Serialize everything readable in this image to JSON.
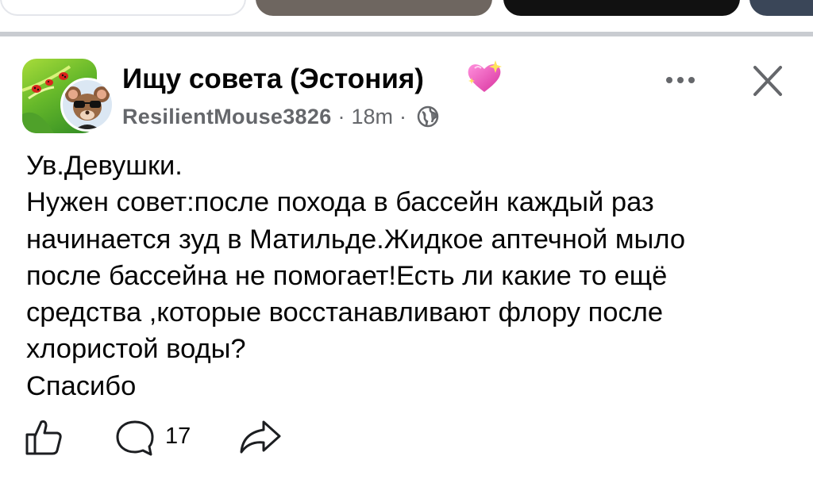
{
  "post": {
    "group_name": "Ищу совета (Эстония)",
    "author": "ResilientMouse3826",
    "separator_1": "·",
    "time": "18m",
    "separator_2": "·",
    "body_lines": [
      "Ув.Девушки.",
      "Нужен совет:после похода в бассейн каждый раз",
      "начинается зуд в Матильде.Жидкое аптечной мыло",
      "после бассейна не помогает!Есть ли какие то ещё",
      "средства ,которые восстанавливают флору после",
      "хлористой воды?",
      "Спасибо"
    ]
  },
  "actions": {
    "comment_count": "17"
  },
  "icons": {
    "heart": "sparkling-heart-icon",
    "audience": "globe-icon",
    "more": "more-options-icon",
    "close": "close-icon",
    "like": "like-icon",
    "comment": "comment-icon",
    "share": "share-icon"
  },
  "colors": {
    "primary_text": "#050505",
    "secondary_text": "#65676b",
    "divider": "#c9ccd1",
    "heart": "#f25bc8"
  }
}
